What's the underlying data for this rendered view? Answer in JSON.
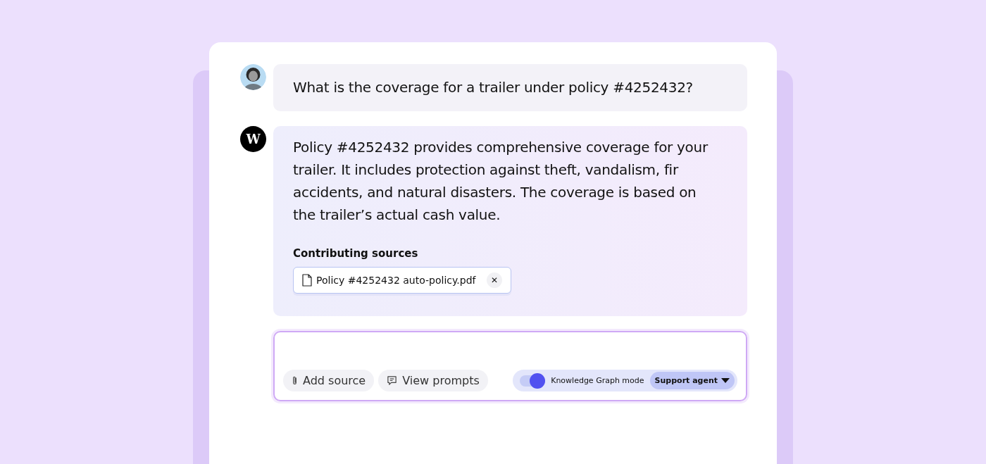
{
  "messages": [
    {
      "kind": "user",
      "text": "What is the coverage for a trailer under policy #4252432?"
    },
    {
      "kind": "assistant",
      "avatar": {
        "logo": "W"
      },
      "text": "Policy #4252432 provides comprehensive coverage for your trailer. It includes protection against theft, vandalism, fir accidents, and natural disasters. The coverage is based on the trailer’s actual cash value.",
      "sources_label": "Contributing sources",
      "sources": [
        {
          "name": "Policy #4252432 auto-policy.pdf",
          "close": "✕"
        }
      ]
    }
  ],
  "composer": {
    "buttons": [
      {
        "kind": "attach",
        "label": "Add source"
      },
      {
        "kind": "prompts",
        "label": "View prompts"
      }
    ],
    "toggle": {
      "label": "Knowledge Graph mode",
      "on": true
    },
    "dropdown": {
      "label": "Support agent"
    }
  }
}
